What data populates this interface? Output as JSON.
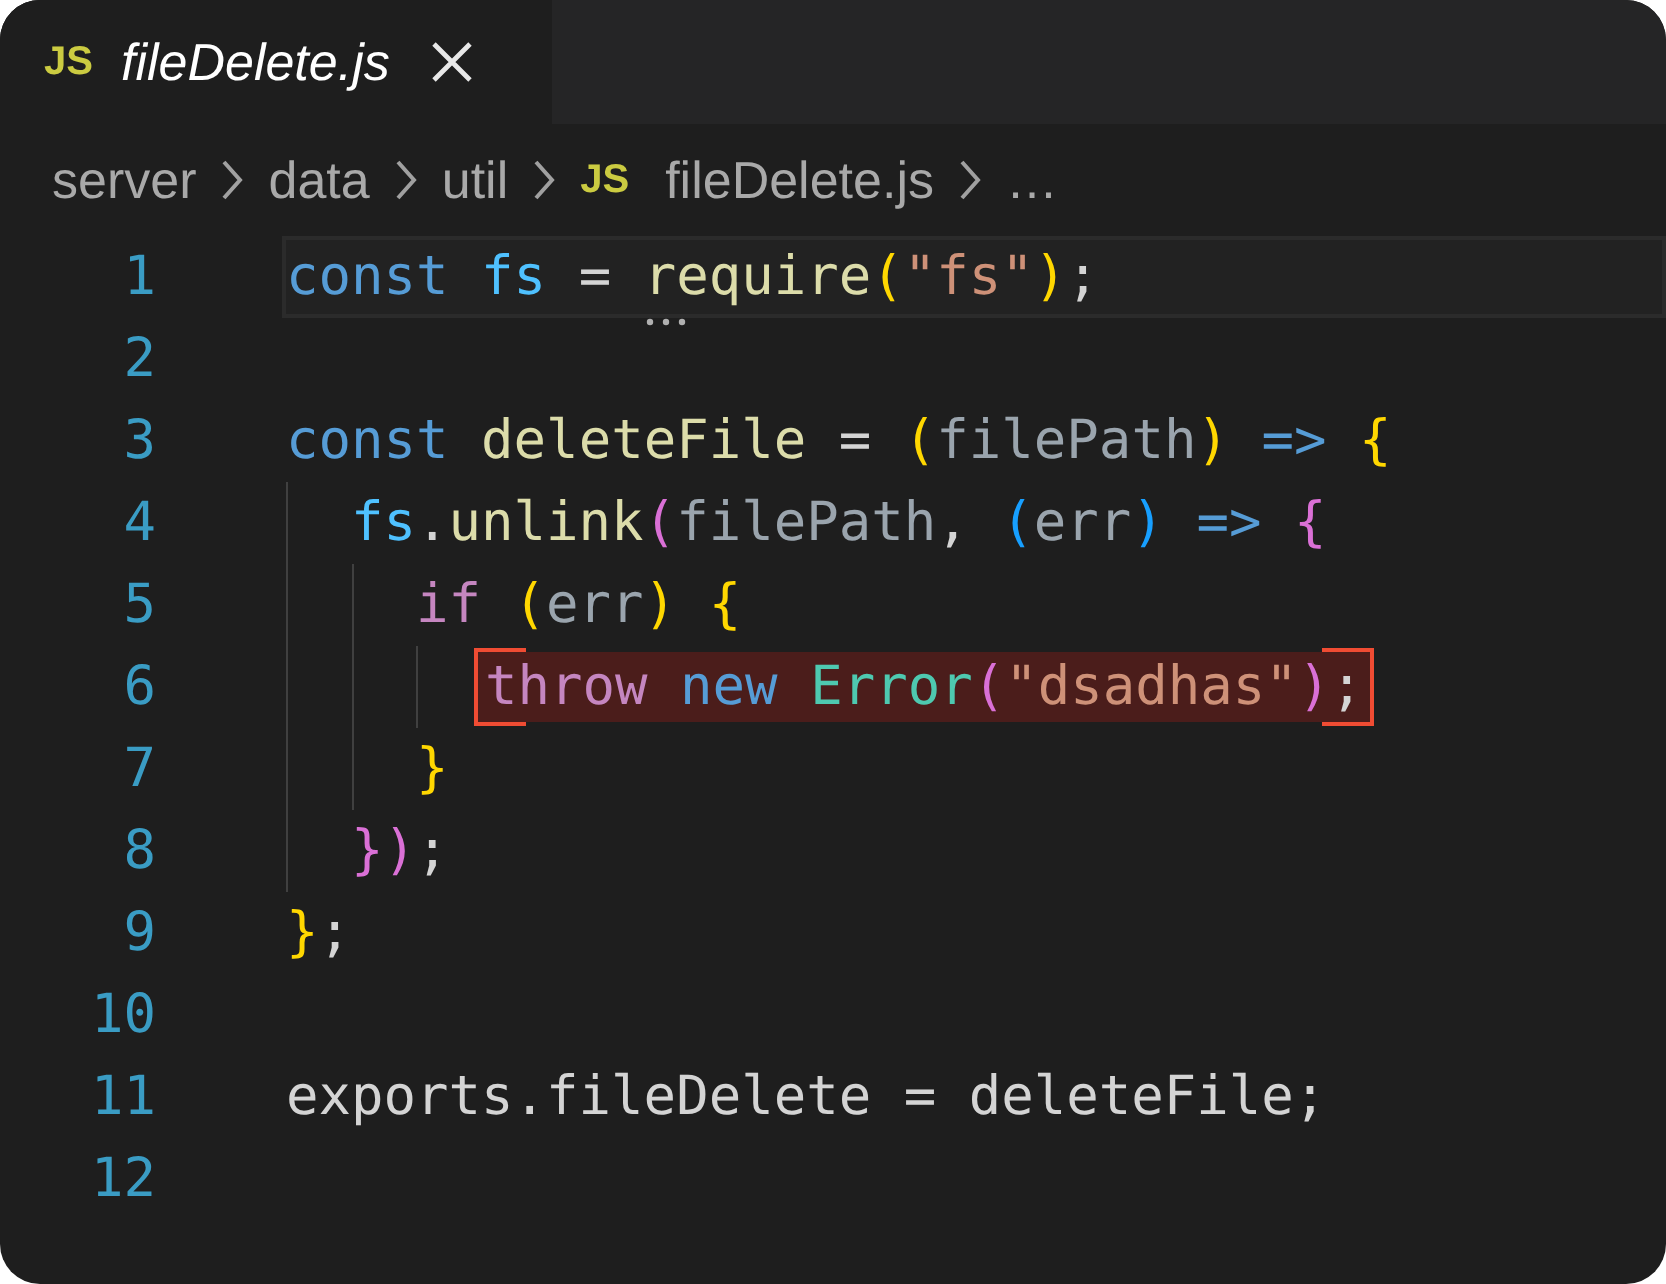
{
  "tab": {
    "icon_label": "JS",
    "title": "fileDelete.js",
    "preview": true,
    "selected": true
  },
  "breadcrumbs": [
    {
      "label": "server"
    },
    {
      "label": "data"
    },
    {
      "label": "util"
    },
    {
      "label": "fileDelete.js",
      "icon_label": "JS"
    },
    {
      "label": "…"
    }
  ],
  "lines": [
    {
      "number": "1",
      "current": true,
      "highlighted": false,
      "tokens": [
        {
          "t": "const ",
          "kind": "keyword"
        },
        {
          "t": "fs",
          "kind": "variable"
        },
        {
          "t": " = "
        },
        {
          "t": "require",
          "kind": "function",
          "hint": true
        },
        {
          "t": "(",
          "kind": "bracket1"
        },
        {
          "t": "\"fs\"",
          "kind": "string"
        },
        {
          "t": ")",
          "kind": "bracket1"
        },
        {
          "t": ";"
        }
      ]
    },
    {
      "number": "2",
      "current": false,
      "highlighted": false
    },
    {
      "number": "3",
      "current": false,
      "highlighted": false,
      "tokens": [
        {
          "t": "const ",
          "kind": "keyword"
        },
        {
          "t": "deleteFile",
          "kind": "function"
        },
        {
          "t": " = "
        },
        {
          "t": "(",
          "kind": "bracket1"
        },
        {
          "t": "filePath",
          "kind": "param"
        },
        {
          "t": ")",
          "kind": "bracket1"
        },
        {
          "t": " => ",
          "kind": "keyword"
        },
        {
          "t": "{",
          "kind": "bracket1"
        }
      ]
    },
    {
      "number": "4",
      "current": false,
      "highlighted": false,
      "tokens": [
        {
          "t": "  fs",
          "kind": "variable"
        },
        {
          "t": "."
        },
        {
          "t": "unlink",
          "kind": "function"
        },
        {
          "t": "(",
          "kind": "bracket2"
        },
        {
          "t": "filePath",
          "kind": "param"
        },
        {
          "t": ", "
        },
        {
          "t": "(",
          "kind": "bracket3"
        },
        {
          "t": "err",
          "kind": "param"
        },
        {
          "t": ")",
          "kind": "bracket3"
        },
        {
          "t": " => ",
          "kind": "keyword"
        },
        {
          "t": "{",
          "kind": "bracket2"
        }
      ]
    },
    {
      "number": "5",
      "current": false,
      "highlighted": false,
      "tokens": [
        {
          "t": "    if ",
          "kind": "control"
        },
        {
          "t": "(",
          "kind": "bracket1"
        },
        {
          "t": "err",
          "kind": "param"
        },
        {
          "t": ") {",
          "kind": "bracket1"
        }
      ]
    },
    {
      "number": "6",
      "current": false,
      "highlighted": true,
      "tokens": [
        {
          "t": "      throw",
          "kind": "control"
        },
        {
          "t": " new",
          "kind": "keyword"
        },
        {
          "t": " Error",
          "kind": "class"
        },
        {
          "t": "(",
          "kind": "bracket2"
        },
        {
          "t": "\"dsadhas\"",
          "kind": "string"
        },
        {
          "t": ")",
          "kind": "bracket2"
        },
        {
          "t": ";"
        }
      ]
    },
    {
      "number": "7",
      "current": false,
      "highlighted": false,
      "tokens": [
        {
          "t": "    }",
          "kind": "bracket1"
        }
      ]
    },
    {
      "number": "8",
      "current": false,
      "highlighted": false,
      "tokens": [
        {
          "t": "  })",
          "kind": "bracket2"
        },
        {
          "t": ";"
        }
      ]
    },
    {
      "number": "9",
      "current": false,
      "highlighted": false,
      "tokens": [
        {
          "t": "}",
          "kind": "bracket1"
        },
        {
          "t": ";"
        }
      ]
    },
    {
      "number": "10",
      "current": false,
      "highlighted": false
    },
    {
      "number": "11",
      "current": false,
      "highlighted": false,
      "tokens": [
        {
          "t": "exports.fileDelete = deleteFile;"
        }
      ]
    },
    {
      "number": "12",
      "current": false,
      "highlighted": false
    }
  ]
}
